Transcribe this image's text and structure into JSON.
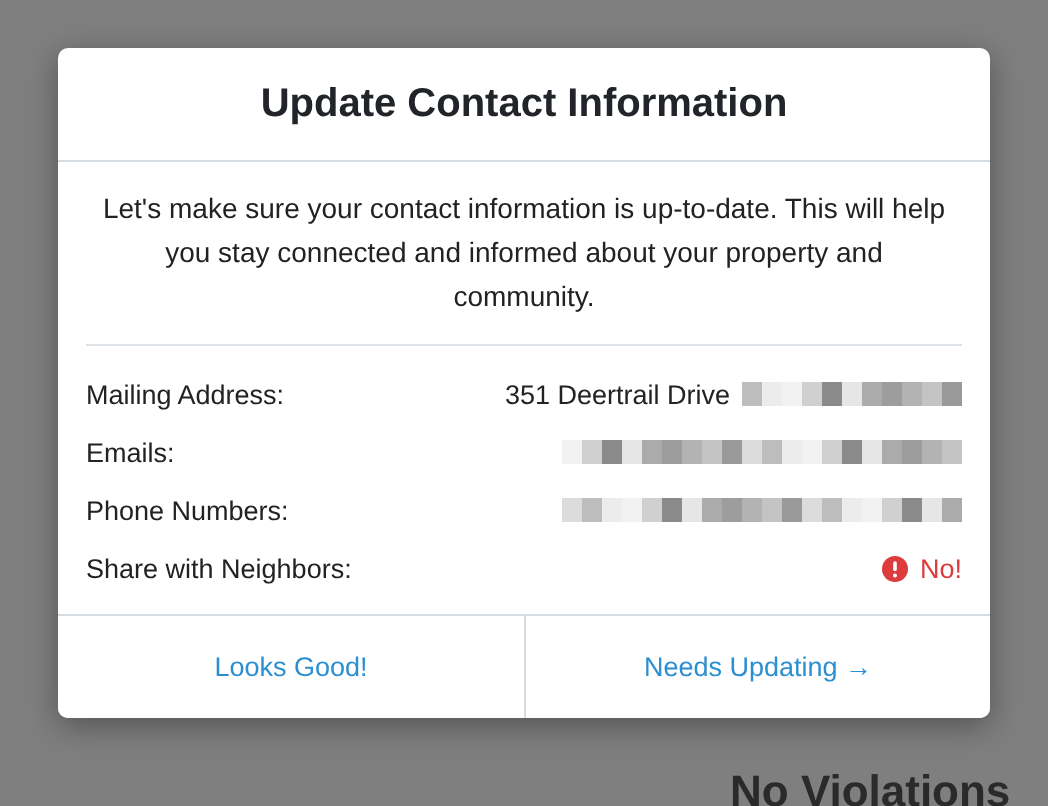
{
  "background": {
    "heading": "No Violations"
  },
  "modal": {
    "title": "Update Contact Information",
    "intro": "Let's make sure your contact information is up-to-date. This will help you stay connected and informed about your property and community.",
    "rows": [
      {
        "label": "Mailing Address:",
        "kind": "text-redacted",
        "value": "351 Deertrail Drive"
      },
      {
        "label": "Emails:",
        "kind": "redacted"
      },
      {
        "label": "Phone Numbers:",
        "kind": "redacted"
      },
      {
        "label": "Share with Neighbors:",
        "kind": "alert",
        "value": "No!"
      }
    ],
    "buttons": [
      {
        "label": "Looks Good!"
      },
      {
        "label": "Needs Updating →"
      }
    ]
  }
}
